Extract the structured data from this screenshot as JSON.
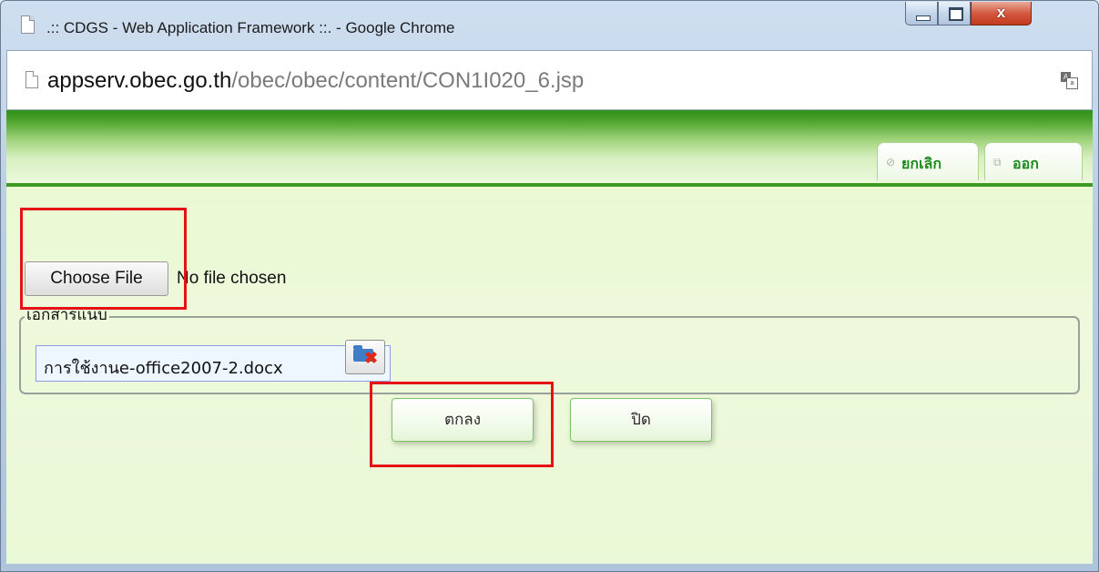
{
  "window": {
    "title": ".:: CDGS - Web Application Framework ::. - Google Chrome",
    "close_glyph": "x"
  },
  "address_bar": {
    "host": "appserv.obec.go.th",
    "path": "/obec/obec/content/CON1I020_6.jsp",
    "translate_glyph_a": "A",
    "translate_glyph_b": "a"
  },
  "header": {
    "cancel_label": "ยกเลิก",
    "exit_label": "ออก",
    "cancel_icon": "⊘",
    "exit_icon": "⧉"
  },
  "form": {
    "choose_file_label": "Choose File",
    "file_status": "No file chosen",
    "legend": "เอกสารแนบ",
    "attachment_name": "การใช้งานe-office2007-2.docx",
    "ok_label": "ตกลง",
    "close_label": "ปิด"
  },
  "colors": {
    "header_green": "#3c9a22",
    "highlight_red": "#e51313"
  },
  "icons": [
    "page-icon",
    "translate-icon",
    "cancel-icon",
    "exit-icon",
    "folder-delete-icon"
  ]
}
